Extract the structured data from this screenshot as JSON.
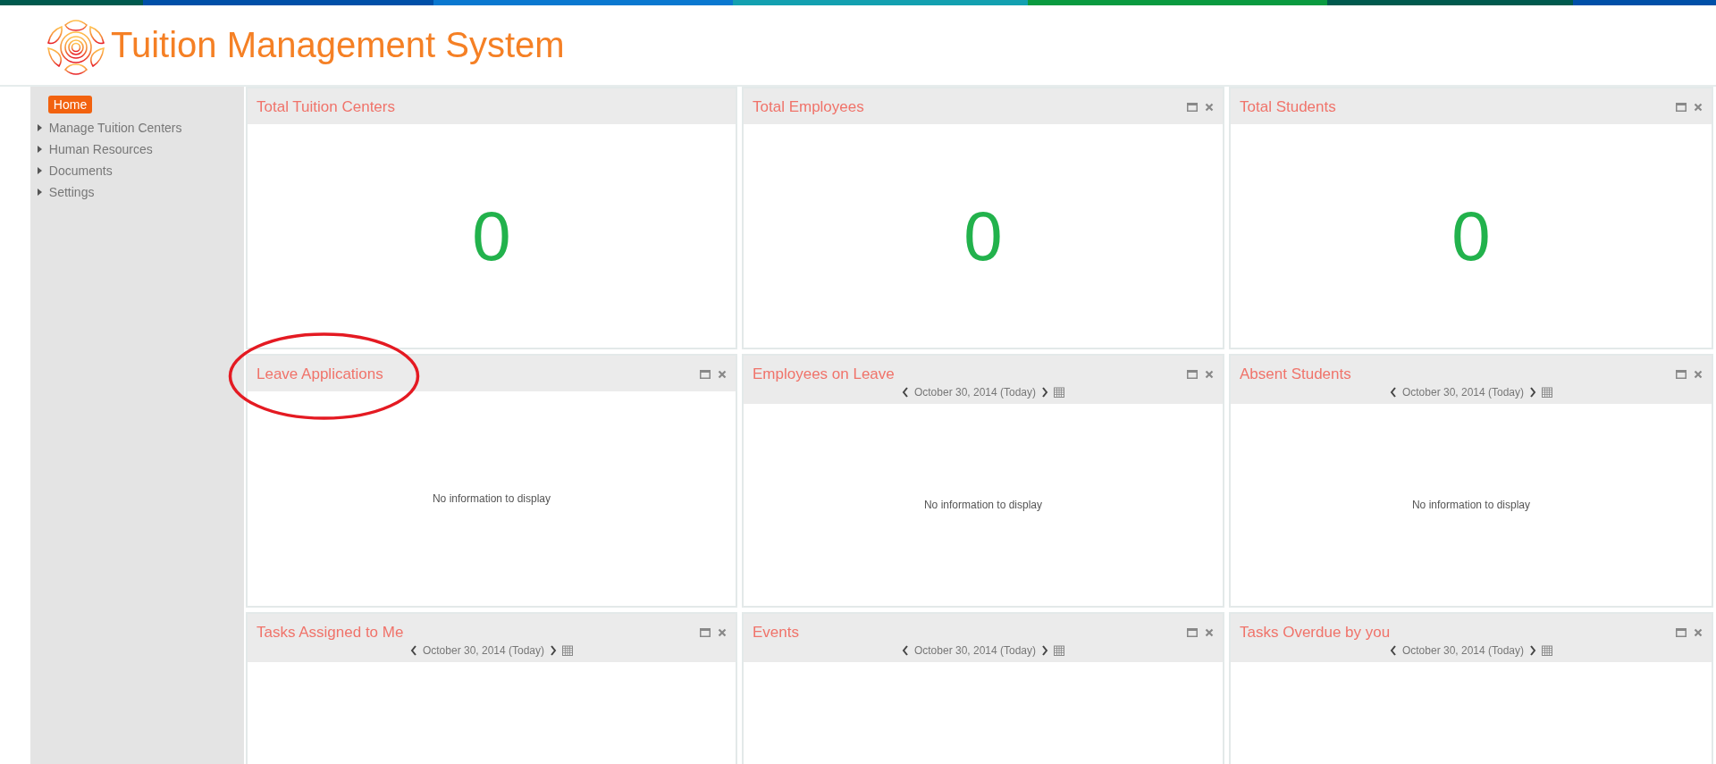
{
  "header": {
    "title": "Tuition Management System"
  },
  "sidebar": {
    "items": [
      {
        "label": "Home",
        "selected": true,
        "kind": "link"
      },
      {
        "label": "Manage Tuition Centers",
        "selected": false,
        "kind": "folder"
      },
      {
        "label": "Human Resources",
        "selected": false,
        "kind": "folder"
      },
      {
        "label": "Documents",
        "selected": false,
        "kind": "folder"
      },
      {
        "label": "Settings",
        "selected": false,
        "kind": "folder"
      }
    ]
  },
  "widgets": [
    {
      "title": "Total Tuition Centers",
      "kind": "count",
      "controls": false,
      "value": "0",
      "circled": false
    },
    {
      "title": "Total Employees",
      "kind": "count",
      "controls": true,
      "value": "0",
      "circled": false
    },
    {
      "title": "Total Students",
      "kind": "count",
      "controls": true,
      "value": "0",
      "circled": false
    },
    {
      "title": "Leave Applications",
      "kind": "list",
      "controls": true,
      "message": "No information to display",
      "circled": true
    },
    {
      "title": "Employees on Leave",
      "kind": "list",
      "controls": true,
      "date": "October 30, 2014 (Today)",
      "message": "No information to display",
      "circled": false
    },
    {
      "title": "Absent Students",
      "kind": "list",
      "controls": true,
      "date": "October 30, 2014 (Today)",
      "message": "No information to display",
      "circled": false
    },
    {
      "title": "Tasks Assigned to Me",
      "kind": "list",
      "controls": true,
      "date": "October 30, 2014 (Today)",
      "circled": false
    },
    {
      "title": "Events",
      "kind": "list",
      "controls": true,
      "date": "October 30, 2014 (Today)",
      "circled": false
    },
    {
      "title": "Tasks Overdue by you",
      "kind": "list",
      "controls": true,
      "date": "October 30, 2014 (Today)",
      "circled": false
    }
  ]
}
